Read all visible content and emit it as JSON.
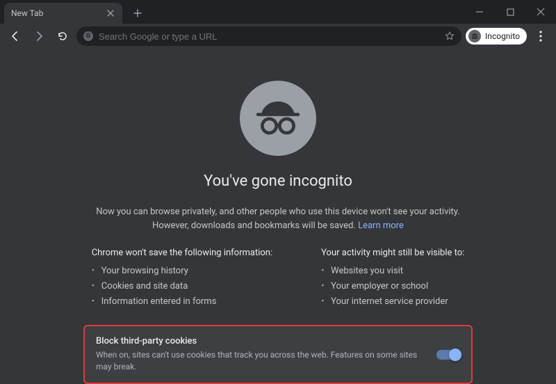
{
  "window": {
    "tab_title": "New Tab"
  },
  "toolbar": {
    "omnibox_placeholder": "Search Google or type a URL",
    "incognito_label": "Incognito"
  },
  "page": {
    "heading": "You've gone incognito",
    "intro_line1": "Now you can browse privately, and other people who use this device won't see your activity.",
    "intro_line2_prefix": "However, downloads and bookmarks will be saved. ",
    "learn_more": "Learn more",
    "left": {
      "title": "Chrome won't save the following information:",
      "items": [
        "Your browsing history",
        "Cookies and site data",
        "Information entered in forms"
      ]
    },
    "right": {
      "title": "Your activity might still be visible to:",
      "items": [
        "Websites you visit",
        "Your employer or school",
        "Your internet service provider"
      ]
    },
    "cookies": {
      "title": "Block third-party cookies",
      "desc": "When on, sites can't use cookies that track you across the web. Features on some sites may break."
    }
  }
}
